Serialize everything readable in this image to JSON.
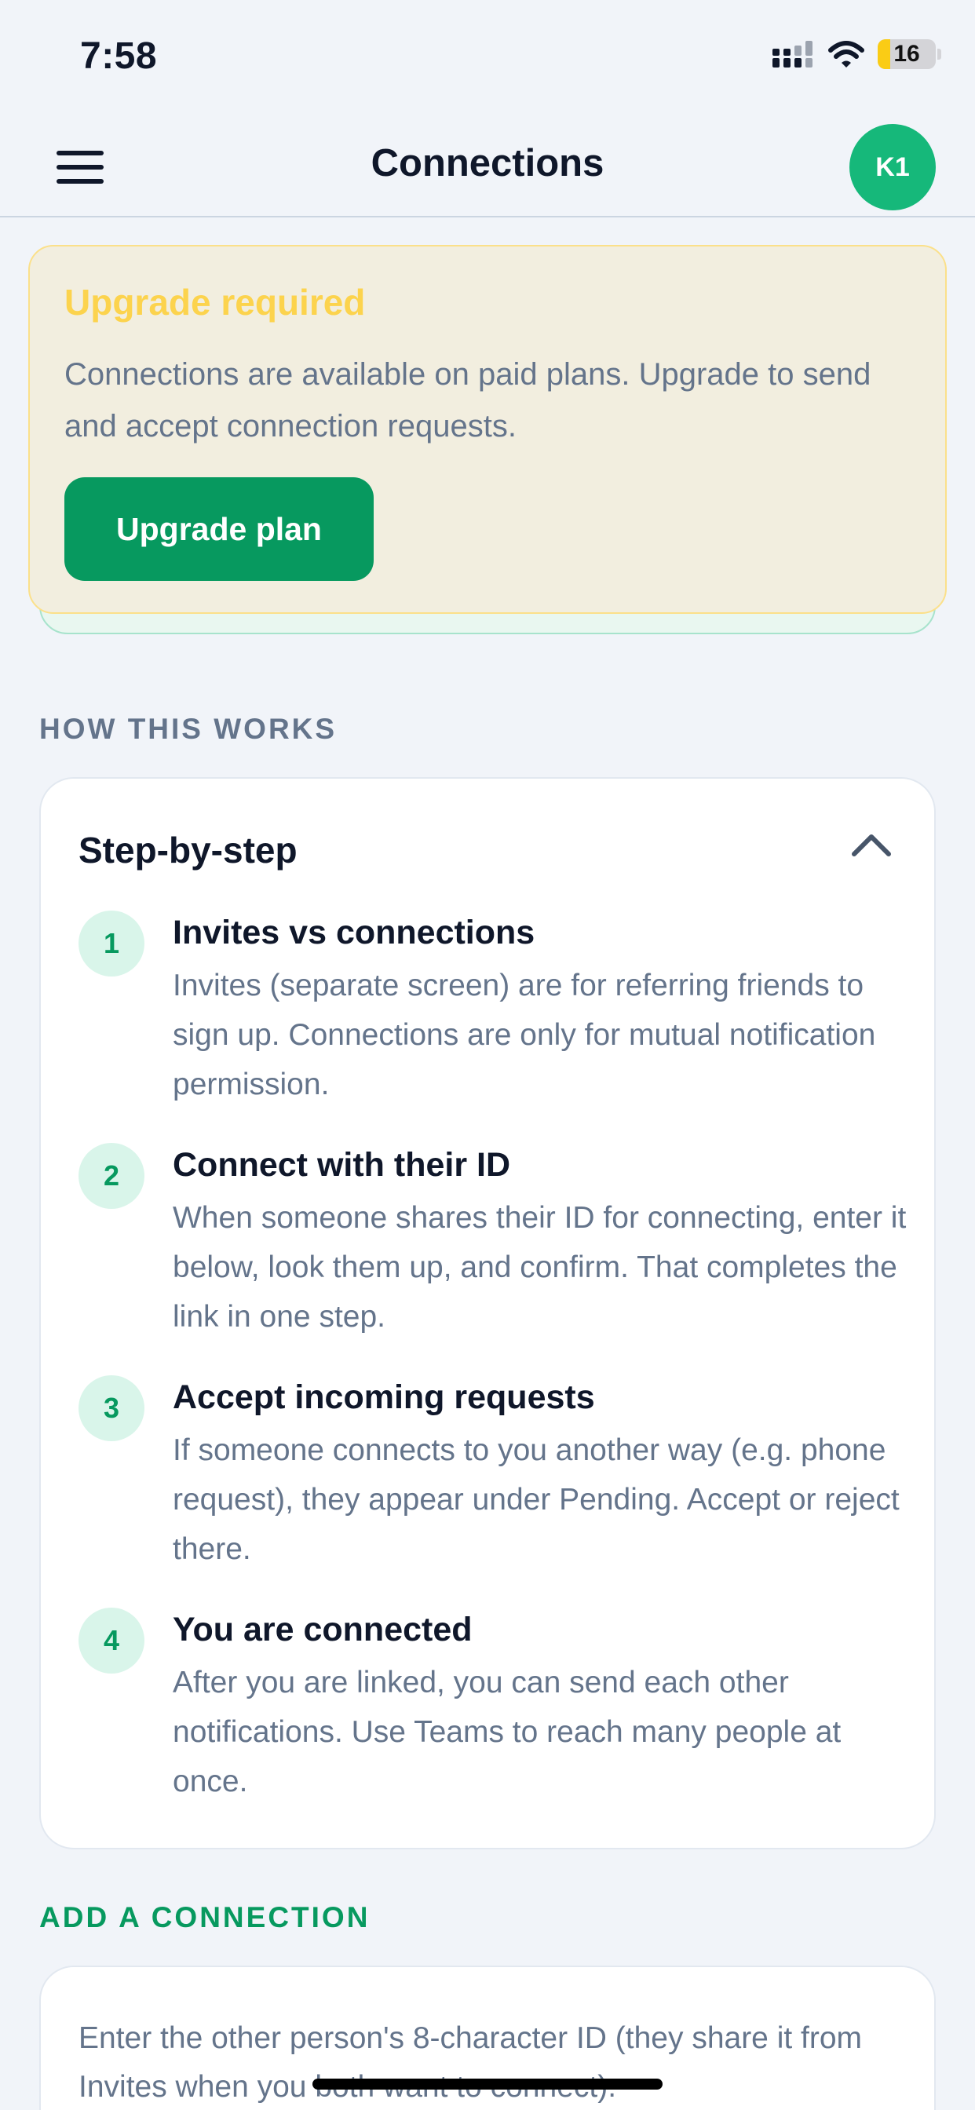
{
  "status_bar": {
    "time": "7:58",
    "battery": "16"
  },
  "header": {
    "title": "Connections",
    "avatar_initials": "K1"
  },
  "upgrade": {
    "title": "Upgrade required",
    "message": "Connections are available on paid plans. Upgrade to send and accept connection requests.",
    "button_label": "Upgrade plan"
  },
  "how_it_works": {
    "section_label": "HOW THIS WORKS",
    "card_title": "Step-by-step",
    "steps": [
      {
        "number": "1",
        "title": "Invites vs connections",
        "body": "Invites (separate screen) are for referring friends to sign up. Connections are only for mutual notification permission."
      },
      {
        "number": "2",
        "title": "Connect with their ID",
        "body": "When someone shares their ID for connecting, enter it below, look them up, and confirm. That completes the link in one step."
      },
      {
        "number": "3",
        "title": "Accept incoming requests",
        "body": "If someone connects to you another way (e.g. phone request), they appear under Pending. Accept or reject there."
      },
      {
        "number": "4",
        "title": "You are connected",
        "body": "After you are linked, you can send each other notifications. Use Teams to reach many people at once."
      }
    ]
  },
  "add_connection": {
    "section_label": "ADD A CONNECTION",
    "instructions": "Enter the other person's 8-character ID (they share it from Invites when you both want to connect)."
  },
  "colors": {
    "accent": "#07995f",
    "avatar": "#16b87a",
    "warning_title": "#fcd34d",
    "warning_bg": "#f2eedf"
  }
}
